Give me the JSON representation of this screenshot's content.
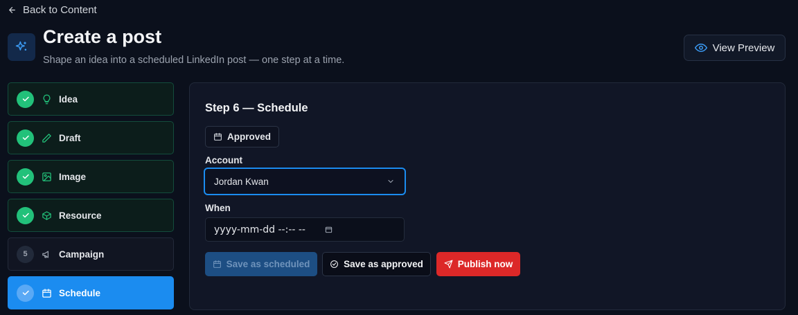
{
  "nav": {
    "back_label": "Back to Content",
    "back_icon": "arrow-left-icon"
  },
  "header": {
    "icon": "sparkles-icon",
    "title": "Create a post",
    "subtitle": "Shape an idea into a scheduled LinkedIn post — one step at a time.",
    "preview_label": "View Preview",
    "preview_icon": "eye-icon"
  },
  "steps": [
    {
      "label": "Idea",
      "state": "done",
      "icon": "lightbulb-icon"
    },
    {
      "label": "Draft",
      "state": "done",
      "icon": "pencil-icon"
    },
    {
      "label": "Image",
      "state": "done",
      "icon": "image-icon"
    },
    {
      "label": "Resource",
      "state": "done",
      "icon": "box-icon"
    },
    {
      "label": "Campaign",
      "state": "pending",
      "number": "5",
      "icon": "megaphone-icon"
    },
    {
      "label": "Schedule",
      "state": "active",
      "icon": "calendar-icon"
    }
  ],
  "panel": {
    "title": "Step 6 — Schedule",
    "status": "Approved",
    "account_label": "Account",
    "account_value": "Jordan Kwan",
    "when_label": "When",
    "when_placeholder": "yyyy-mm-dd --:-- --",
    "buttons": {
      "save_scheduled": "Save as scheduled",
      "save_approved": "Save as approved",
      "publish": "Publish now"
    }
  },
  "colors": {
    "background": "#0b101c",
    "accent": "#1b8cf0",
    "success": "#22c17a",
    "danger": "#dc2828"
  }
}
